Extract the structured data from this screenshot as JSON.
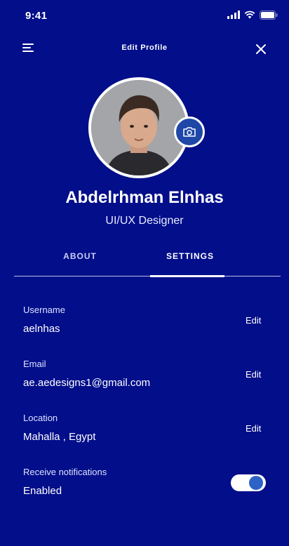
{
  "status_bar": {
    "time": "9:41"
  },
  "header": {
    "title": "Edit Profile"
  },
  "profile": {
    "name": "Abdelrhman Elnhas",
    "role": "UI/UX Designer"
  },
  "tabs": [
    {
      "label": "ABOUT",
      "active": false
    },
    {
      "label": "SETTINGS",
      "active": true
    }
  ],
  "fields": {
    "username": {
      "label": "Username",
      "value": "aelnhas",
      "action": "Edit"
    },
    "email": {
      "label": "Email",
      "value": "ae.aedesigns1@gmail.com",
      "action": "Edit"
    },
    "location": {
      "label": "Location",
      "value": "Mahalla , Egypt",
      "action": "Edit"
    },
    "notifications": {
      "label": "Receive notifications",
      "value": "Enabled",
      "toggle_on": true
    }
  },
  "colors": {
    "background": "#020e8a",
    "accent": "#2d63c7",
    "text": "#ffffff"
  },
  "icons": [
    "signal-icon",
    "wifi-icon",
    "battery-icon",
    "menu-icon",
    "close-icon",
    "camera-icon"
  ]
}
